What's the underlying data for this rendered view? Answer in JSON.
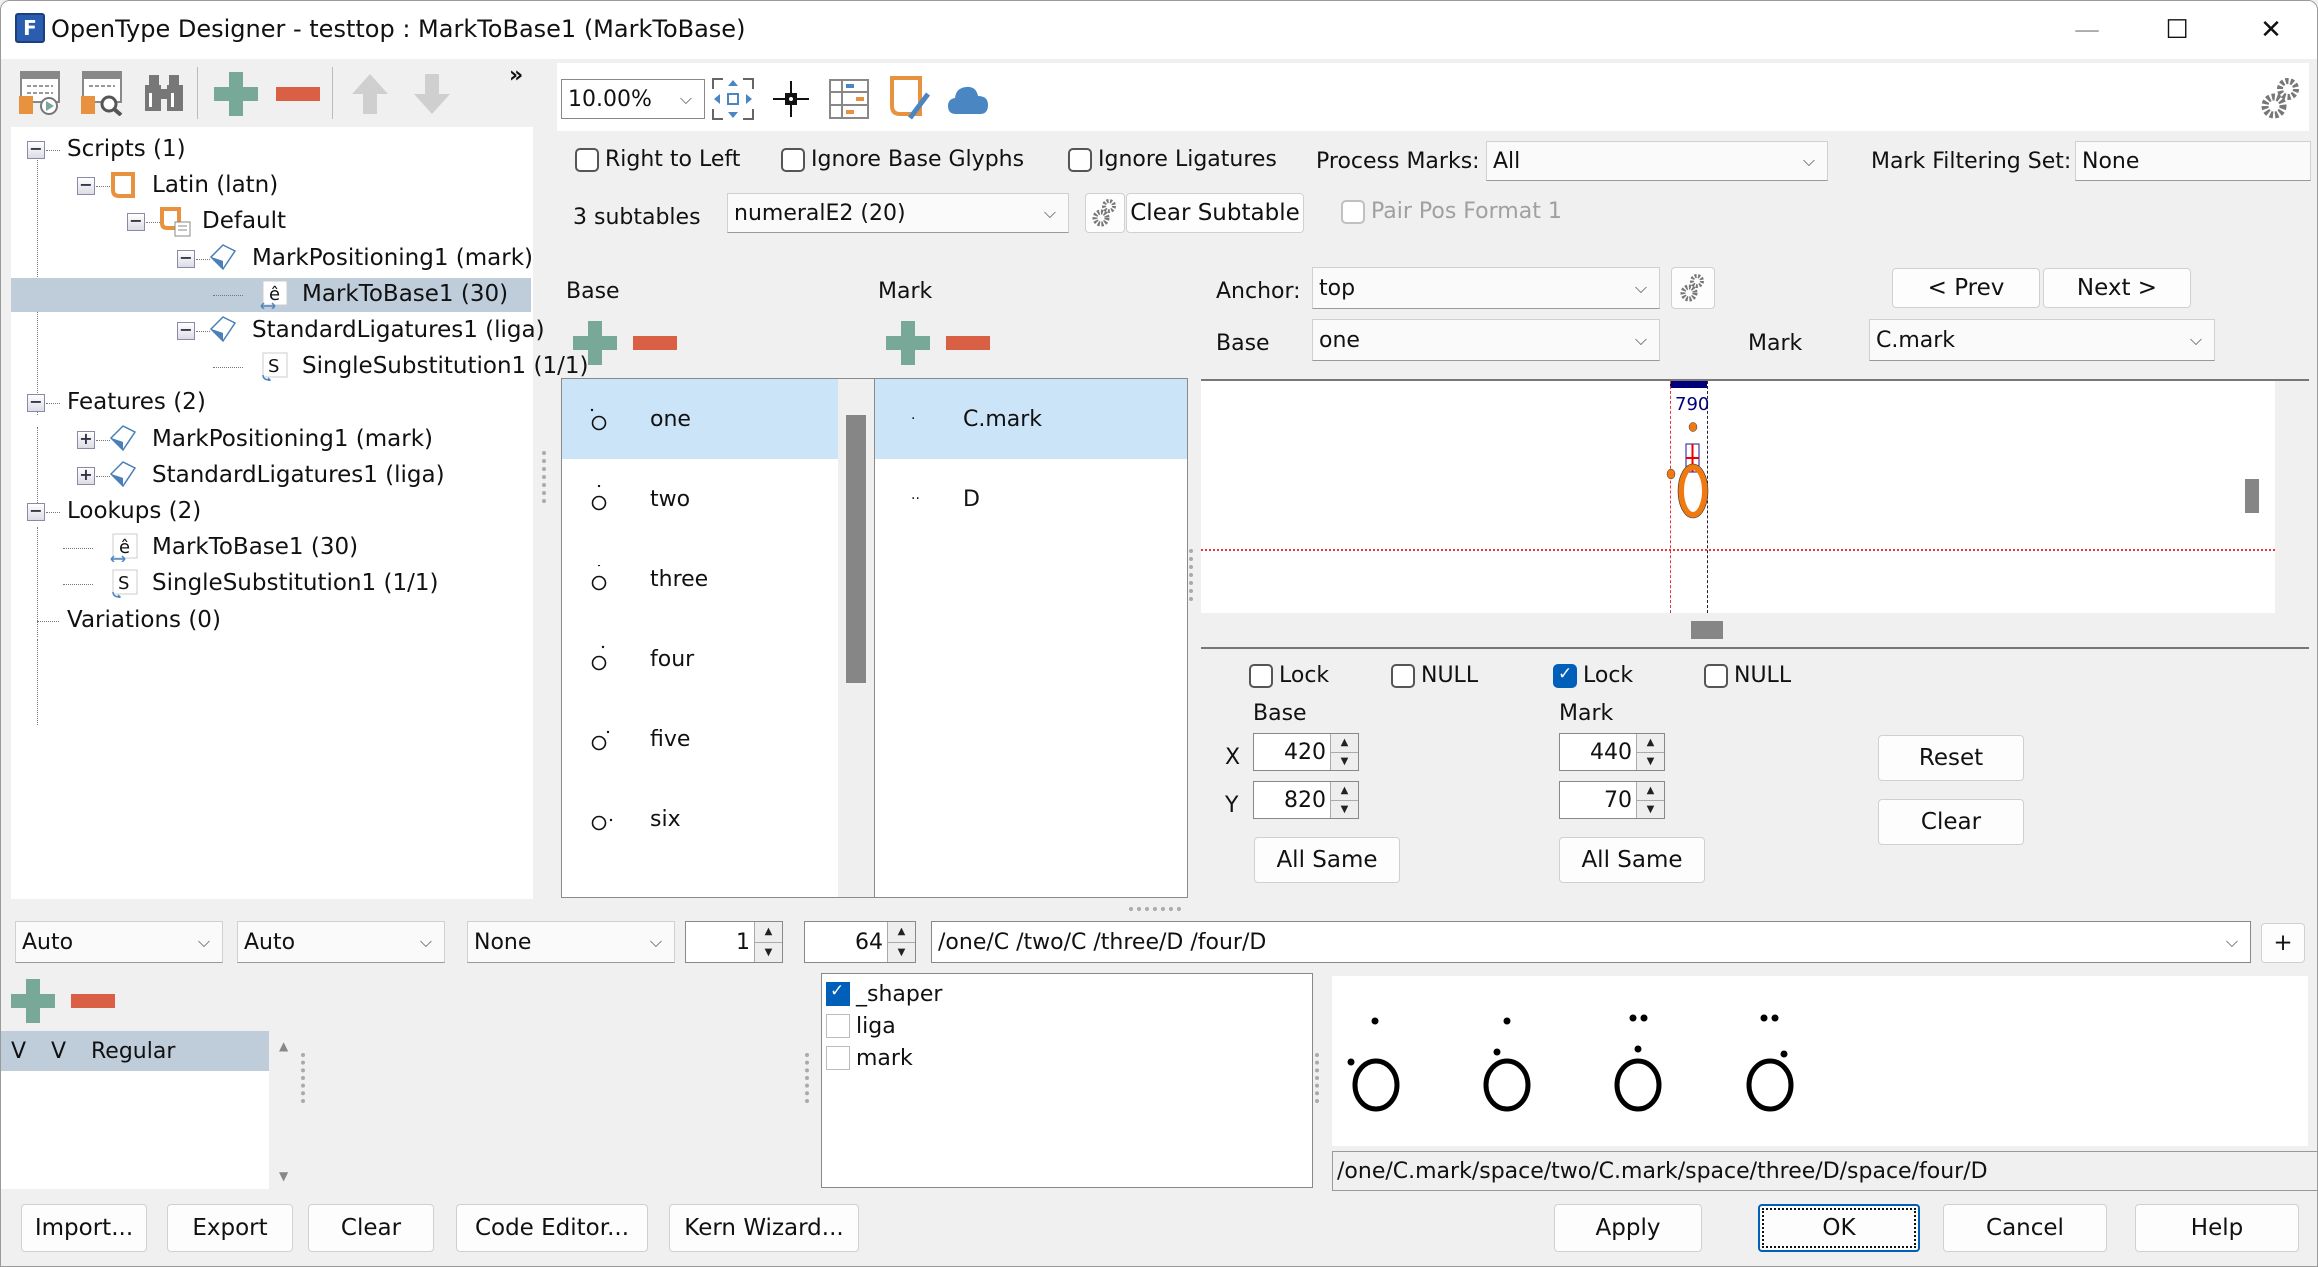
{
  "window": {
    "title": "OpenType Designer - testtop : MarkToBase1 (MarkToBase)",
    "app_icon_letter": "F",
    "minimize": "—",
    "maximize": "☐",
    "close": "✕"
  },
  "left_toolbar": {
    "overflow": "»",
    "icons": [
      "apply-feature-icon",
      "preview-feature-icon",
      "binoculars-icon",
      "add-icon",
      "remove-icon",
      "move-up-icon",
      "move-down-icon"
    ]
  },
  "tree": {
    "items": [
      {
        "label": "Scripts (1)",
        "level": 0,
        "expander": "−",
        "icon": null
      },
      {
        "label": "Latin (latn)",
        "level": 1,
        "expander": "−",
        "icon": "script-icon"
      },
      {
        "label": "Default",
        "level": 2,
        "expander": "−",
        "icon": "language-icon"
      },
      {
        "label": "MarkPositioning1 (mark)",
        "level": 3,
        "expander": "−",
        "icon": "feature-icon"
      },
      {
        "label": "MarkToBase1 (30)",
        "level": 4,
        "expander": null,
        "icon": "marktobase-lookup-icon",
        "selected": true
      },
      {
        "label": "StandardLigatures1 (liga)",
        "level": 3,
        "expander": "−",
        "icon": "feature-icon"
      },
      {
        "label": "SingleSubstitution1 (1/1)",
        "level": 4,
        "expander": null,
        "icon": "single-subst-lookup-icon"
      },
      {
        "label": "Features (2)",
        "level": 0,
        "expander": "−",
        "icon": null
      },
      {
        "label": "MarkPositioning1 (mark)",
        "level": 1,
        "expander": "+",
        "icon": "feature-icon"
      },
      {
        "label": "StandardLigatures1 (liga)",
        "level": 1,
        "expander": "+",
        "icon": "feature-icon"
      },
      {
        "label": "Lookups (2)",
        "level": 0,
        "expander": "−",
        "icon": null
      },
      {
        "label": "MarkToBase1 (30)",
        "level": 1,
        "expander": null,
        "icon": "marktobase-lookup-icon"
      },
      {
        "label": "SingleSubstitution1 (1/1)",
        "level": 1,
        "expander": null,
        "icon": "single-subst-lookup-icon"
      },
      {
        "label": "Variations (0)",
        "level": 0,
        "expander": null,
        "icon": null
      }
    ]
  },
  "right_toolbar": {
    "zoom": "10.00%",
    "icons": [
      "fit-view-icon",
      "crosshair-icon",
      "glyph-table-icon",
      "edit-script-icon",
      "cloud-icon"
    ],
    "settings_icon": "gears-icon"
  },
  "options": {
    "right_to_left": {
      "label": "Right to Left",
      "checked": false
    },
    "ignore_base_glyphs": {
      "label": "Ignore Base Glyphs",
      "checked": false
    },
    "ignore_ligatures": {
      "label": "Ignore Ligatures",
      "checked": false
    },
    "process_marks_label": "Process Marks:",
    "process_marks_value": "All",
    "mark_filtering_label": "Mark Filtering Set:",
    "mark_filtering_value": "None",
    "subtables_count": "3 subtables",
    "subtable_value": "numeralE2 (20)",
    "clear_subtable": "Clear Subtable",
    "pair_pos_format": {
      "label": "Pair Pos Format 1",
      "checked": false,
      "disabled": true
    }
  },
  "base_list": {
    "title": "Base",
    "items": [
      {
        "glyph": "one",
        "selected": true
      },
      {
        "glyph": "two"
      },
      {
        "glyph": "three"
      },
      {
        "glyph": "four"
      },
      {
        "glyph": "five"
      },
      {
        "glyph": "six"
      }
    ]
  },
  "mark_list": {
    "title": "Mark",
    "items": [
      {
        "glyph": "C.mark",
        "preview": "·",
        "selected": true
      },
      {
        "glyph": "D",
        "preview": "··"
      }
    ]
  },
  "anchor": {
    "anchor_label": "Anchor:",
    "anchor_value": "top",
    "base_label": "Base",
    "base_value": "one",
    "mark_label": "Mark",
    "mark_value": "C.mark",
    "prev": "< Prev",
    "next": "Next >",
    "advance_width": "790"
  },
  "coords": {
    "base_lock": {
      "label": "Lock",
      "checked": false
    },
    "base_null": {
      "label": "NULL",
      "checked": false
    },
    "mark_lock": {
      "label": "Lock",
      "checked": true
    },
    "mark_null": {
      "label": "NULL",
      "checked": false
    },
    "base_title": "Base",
    "mark_title": "Mark",
    "x_label": "X",
    "y_label": "Y",
    "base_x": "420",
    "base_y": "820",
    "mark_x": "440",
    "mark_y": "70",
    "all_same": "All Same",
    "reset": "Reset",
    "clear": "Clear"
  },
  "preview_controls": {
    "combo1": "Auto",
    "combo2": "Auto",
    "combo3": "None",
    "spin1": "1",
    "spin2": "64",
    "text": "/one/C /two/C /three/D /four/D",
    "add": "+"
  },
  "axes_list": {
    "rows": [
      {
        "c1": "V",
        "c2": "V",
        "c3": "Regular",
        "selected": true
      }
    ]
  },
  "features_list": {
    "items": [
      {
        "label": "_shaper",
        "checked": true
      },
      {
        "label": "liga",
        "checked": false
      },
      {
        "label": "mark",
        "checked": false
      }
    ]
  },
  "glyph_string": "/one/C.mark/space/two/C.mark/space/three/D/space/four/D",
  "bottom_buttons": {
    "import": "Import...",
    "export": "Export",
    "clear": "Clear",
    "code_editor": "Code Editor...",
    "kern_wizard": "Kern Wizard...",
    "apply": "Apply",
    "ok": "OK",
    "cancel": "Cancel",
    "help": "Help"
  }
}
